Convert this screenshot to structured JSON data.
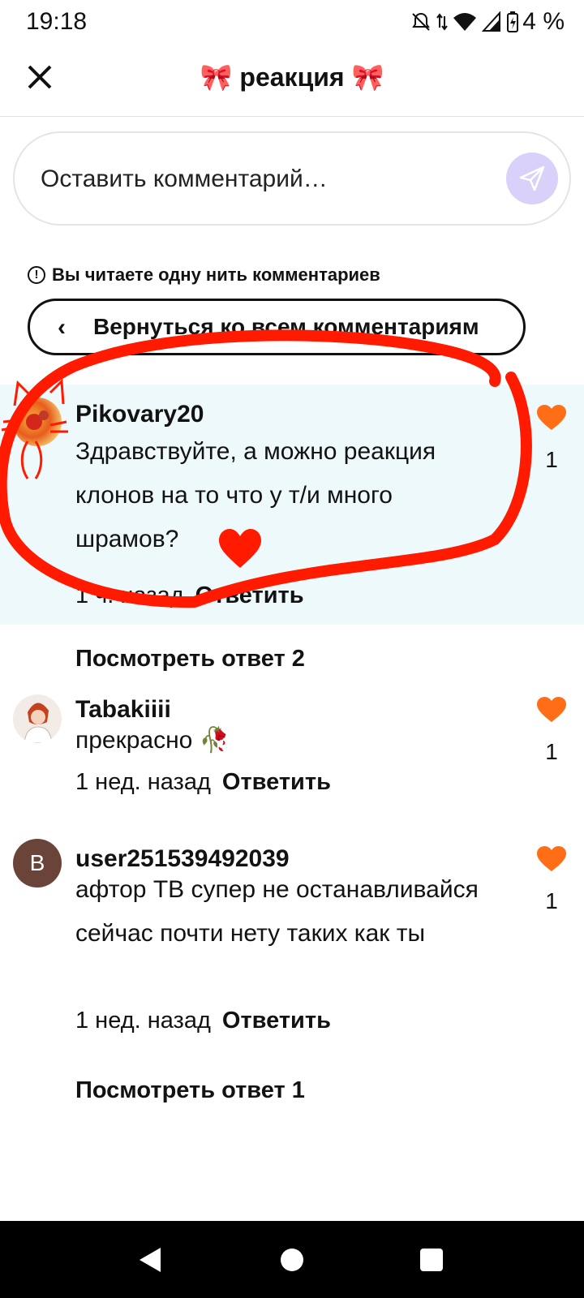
{
  "status": {
    "time": "19:18",
    "battery": "4 %"
  },
  "header": {
    "title": "🎀 реакция 🎀"
  },
  "input": {
    "placeholder": "Оставить комментарий…"
  },
  "thread_notice": "Вы читаете одну нить комментариев",
  "back_button": {
    "label": "Вернуться ко всем комментариям"
  },
  "comments": [
    {
      "user": "Pikovary20",
      "text": "Здравствуйте, а можно реакция клонов на то что у т/и много шрамов?",
      "time": "1 ч. назад",
      "reply_label": "Ответить",
      "likes": "1",
      "highlighted": true
    },
    {
      "user": "Tabakiiii",
      "text": "прекрасно 🥀",
      "time": "1 нед. назад",
      "reply_label": "Ответить",
      "likes": "1"
    },
    {
      "user": "user251539492039",
      "avatar_letter": "B",
      "text": "афтор ТВ супер не останавливайся сейчас почти нету таких как ты",
      "time": "1 нед. назад",
      "reply_label": "Ответить",
      "likes": "1"
    }
  ],
  "view_replies": [
    "Посмотреть ответ 2",
    "Посмотреть ответ 1"
  ],
  "colors": {
    "accent_heart": "#ff6d16",
    "send_bg": "#d9d1f9",
    "highlight_bg": "#eef9fb",
    "annotation_red": "#ff1a00"
  }
}
